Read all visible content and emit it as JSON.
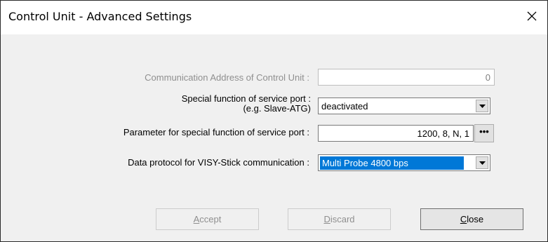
{
  "window": {
    "title": "Control Unit - Advanced Settings",
    "close_glyph": "close-icon"
  },
  "fields": {
    "comm_address": {
      "label": "Communication Address of Control Unit :",
      "value": "0",
      "disabled": true
    },
    "service_port": {
      "label_line1": "Special function of service port :",
      "label_line2": "(e.g. Slave-ATG)",
      "value": "deactivated"
    },
    "service_port_param": {
      "label": "Parameter for special function of service port :",
      "value": "1200, 8, N, 1",
      "button_label": "•••"
    },
    "visy_protocol": {
      "label": "Data protocol for VISY-Stick communication :",
      "value": "Multi Probe 4800 bps"
    }
  },
  "buttons": {
    "accept": {
      "prefix": "",
      "underline": "A",
      "rest": "ccept",
      "disabled": true
    },
    "discard": {
      "prefix": "",
      "underline": "D",
      "rest": "iscard",
      "disabled": true
    },
    "close": {
      "prefix": "",
      "underline": "C",
      "rest": "lose",
      "disabled": false
    }
  }
}
